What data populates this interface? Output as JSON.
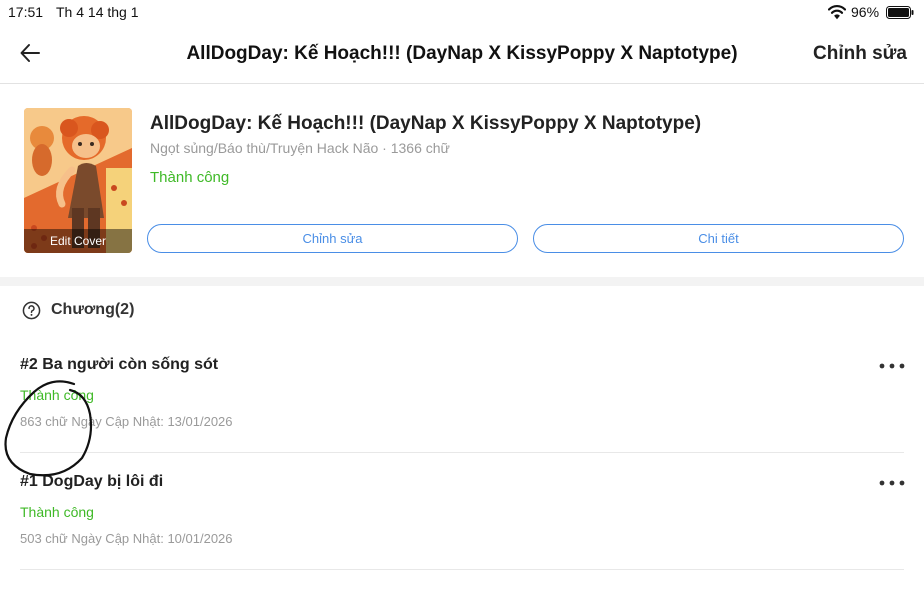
{
  "status_bar": {
    "time": "17:51",
    "date": "Th 4 14 thg 1",
    "battery_percent": "96%",
    "icons": [
      "wifi-icon",
      "battery-icon"
    ]
  },
  "nav": {
    "back_icon": "arrow-left-icon",
    "title": "AllDogDay: Kế Hoạch!!! (DayNap X KissyPoppy X Naptotype)",
    "edit_label": "Chỉnh sửa"
  },
  "story": {
    "cover_label": "Edit Cover",
    "title": "AllDogDay: Kế Hoạch!!! (DayNap X KissyPoppy X Naptotype)",
    "meta": "Ngọt sủng/Báo thù/Truyện Hack Não · 1366 chữ",
    "status": "Thành công",
    "edit_button": "Chỉnh sửa",
    "detail_button": "Chi tiết"
  },
  "chapters": {
    "header": "Chương(2)",
    "help_icon": "question-circle-icon",
    "items": [
      {
        "title": "#2 Ba người còn sống sót",
        "status": "Thành công",
        "meta": "863 chữ Ngày Cập Nhật: 13/01/2026"
      },
      {
        "title": "#1 DogDay bị lôi đi",
        "status": "Thành công",
        "meta": "503 chữ Ngày Cập Nhật: 10/01/2026"
      }
    ]
  },
  "colors": {
    "accent_blue": "#4a8ee6",
    "success_green": "#3fb927",
    "muted_gray": "#9a9a9a"
  }
}
